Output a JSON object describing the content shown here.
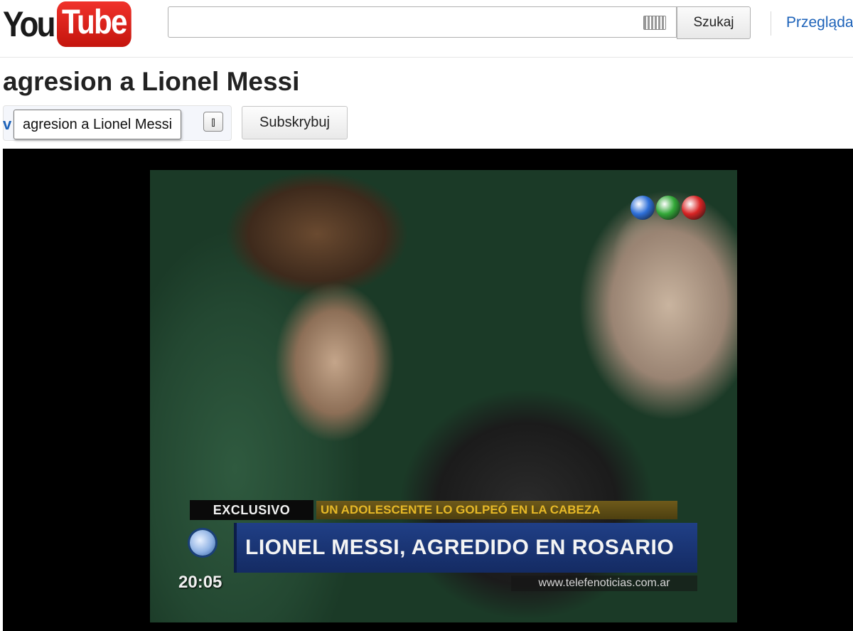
{
  "header": {
    "logo": {
      "you": "You",
      "tube": "Tube"
    },
    "search": {
      "value": "",
      "placeholder": "",
      "keyboard_icon": "keyboard-icon",
      "button_label": "Szukaj"
    },
    "browse_link": "Przeglądaj"
  },
  "video": {
    "title": "agresion a Lionel Messi",
    "channel_initial": "v",
    "tooltip": "agresion a Lionel Messi",
    "expand_icon": "double-chevron-down-icon",
    "subscribe_label": "Subskrybuj"
  },
  "player": {
    "broadcaster_logo_colors": [
      "#2e6fd8",
      "#33a838",
      "#d82424"
    ],
    "overlay": {
      "tag": "EXCLUSIVO",
      "subheadline": "UN ADOLESCENTE LO GOLPEÓ EN LA CABEZA",
      "headline": "LIONEL MESSI, AGREDIDO EN ROSARIO",
      "time": "20:05",
      "url": "www.telefenoticias.com.ar"
    }
  }
}
